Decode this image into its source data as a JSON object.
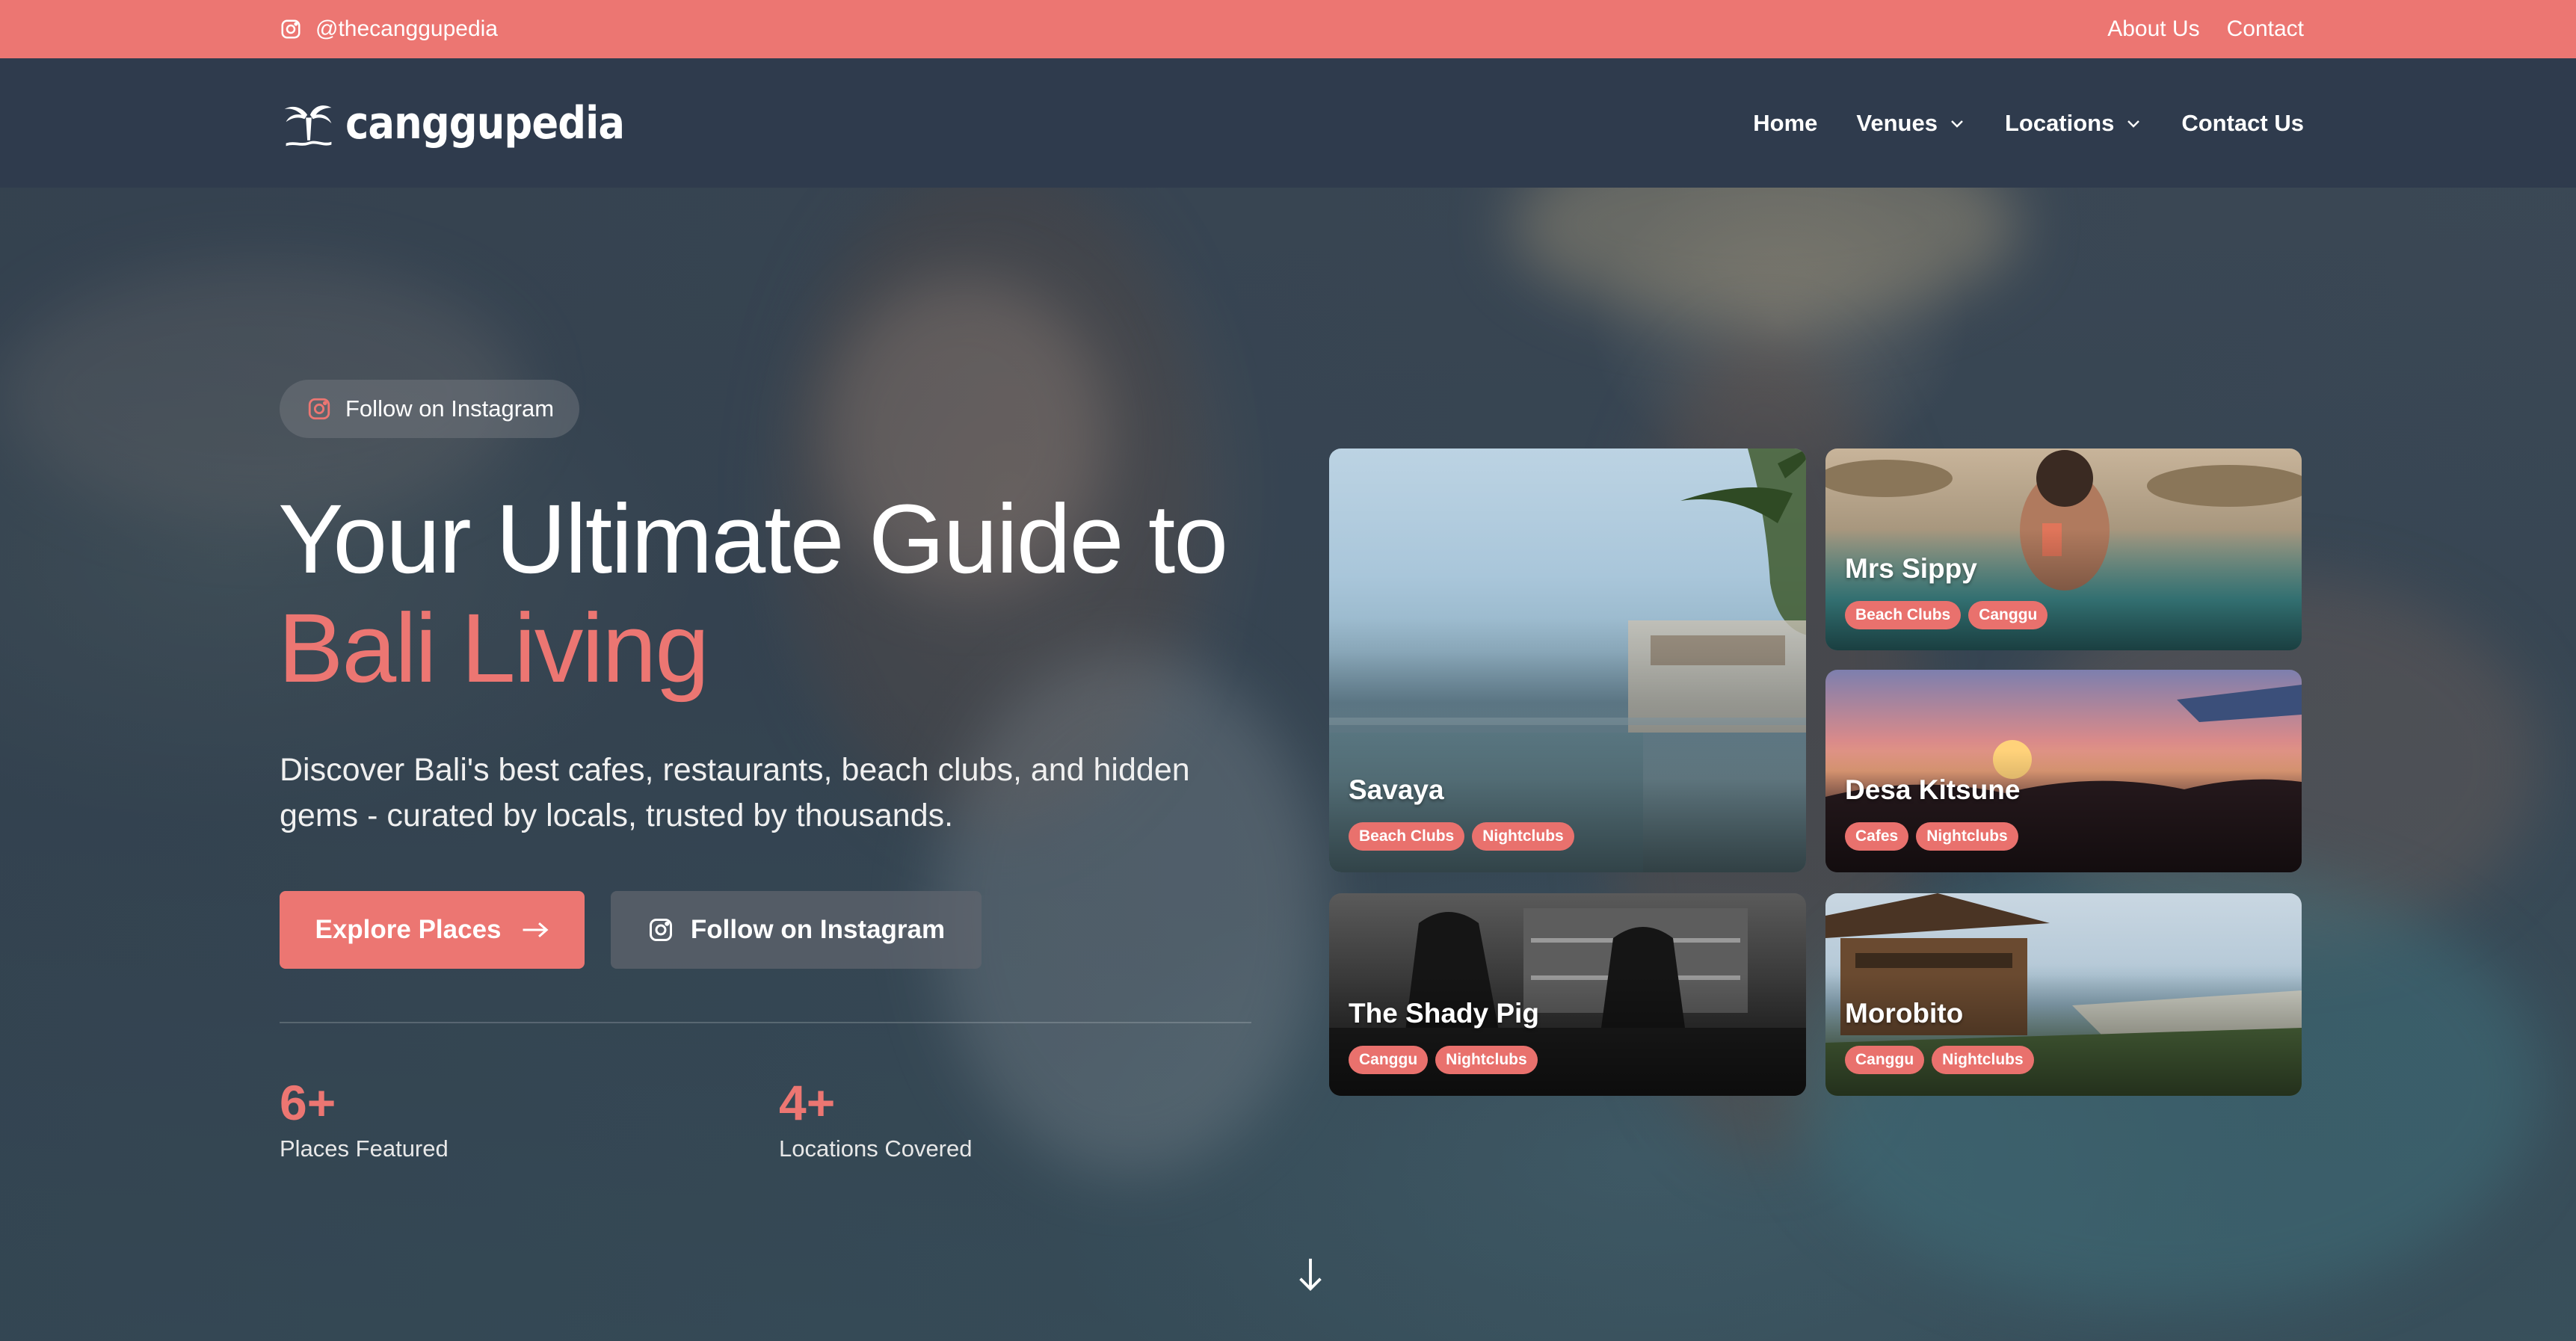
{
  "topbar": {
    "instagram_handle": "@thecanggupedia",
    "links": [
      "About Us",
      "Contact"
    ]
  },
  "nav": {
    "logo_text": "canggupedia",
    "items": [
      {
        "label": "Home",
        "dropdown": false
      },
      {
        "label": "Venues",
        "dropdown": true
      },
      {
        "label": "Locations",
        "dropdown": true
      },
      {
        "label": "Contact Us",
        "dropdown": false
      }
    ]
  },
  "hero": {
    "pill_label": "Follow on Instagram",
    "heading_line1": "Your Ultimate Guide to",
    "heading_line2": "Bali Living",
    "subtitle": "Discover Bali's best cafes, restaurants, beach clubs, and hidden gems - curated by locals, trusted by thousands.",
    "primary_button": "Explore Places",
    "secondary_button": "Follow on Instagram",
    "stats": [
      {
        "value": "6+",
        "label": "Places Featured"
      },
      {
        "value": "4+",
        "label": "Locations Covered"
      }
    ]
  },
  "cards": [
    {
      "title": "Savaya",
      "tags": [
        "Beach Clubs",
        "Nightclubs"
      ]
    },
    {
      "title": "Mrs Sippy",
      "tags": [
        "Beach Clubs",
        "Canggu"
      ]
    },
    {
      "title": "Desa Kitsune",
      "tags": [
        "Cafes",
        "Nightclubs"
      ]
    },
    {
      "title": "The Shady Pig",
      "tags": [
        "Canggu",
        "Nightclubs"
      ]
    },
    {
      "title": "Morobito",
      "tags": [
        "Canggu",
        "Nightclubs"
      ]
    }
  ],
  "colors": {
    "accent": "#ec7672",
    "nav_bg": "#2f3b4d"
  }
}
